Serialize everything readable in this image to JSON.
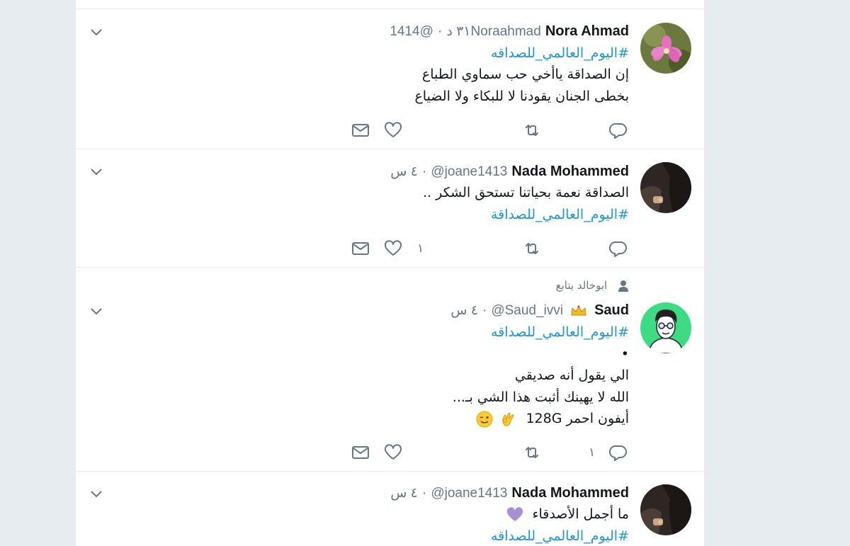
{
  "tweets": [
    {
      "name": "Nora Ahmad",
      "handle": "@1414Noraahmad",
      "time": "٣١ د",
      "lines": [
        "#اليوم_العالمي_للصداقه",
        "إن الصداقة ياأخي حب سماوي الطباع",
        "بخطى الجنان يقودنا لا للبكاء ولا الضياع"
      ],
      "reply_count": "",
      "retweet_count": "",
      "like_count": ""
    },
    {
      "name": "Nada Mohammed",
      "handle": "@joane1413",
      "time": "٤ س",
      "lines": [
        "الصداقة نعمة بحياتنا تستحق الشكر ..",
        "#اليوم_العالمي_للصداقة"
      ],
      "reply_count": "",
      "retweet_count": "",
      "like_count": "١"
    },
    {
      "context": "ابوخالد يتابع",
      "name": "Saud",
      "handle": "@Saud_ivvi",
      "time": "٤ س",
      "lines": [
        "#اليوم_العالمي_للصداقه",
        "•",
        "الي يقول أنه صديقي",
        "الله لا يهينك أثبت هذا الشي بـ...",
        "أيفون احمر 128G"
      ],
      "reply_count": "١",
      "retweet_count": "",
      "like_count": ""
    },
    {
      "name": "Nada Mohammed",
      "handle": "@joane1413",
      "time": "٤ س",
      "lines": [
        "ما أجمل الأصدقاء",
        "#اليوم_العالمي_للصداقه"
      ]
    }
  ],
  "separator": "·",
  "icons": {
    "caret": "chevron-down-icon",
    "reply": "reply-icon",
    "retweet": "retweet-icon",
    "like": "heart-icon",
    "dm": "envelope-icon",
    "follow": "person-icon"
  },
  "colors": {
    "link": "#1b95e0",
    "secondary": "#657786",
    "background": "#e6ecf0"
  }
}
